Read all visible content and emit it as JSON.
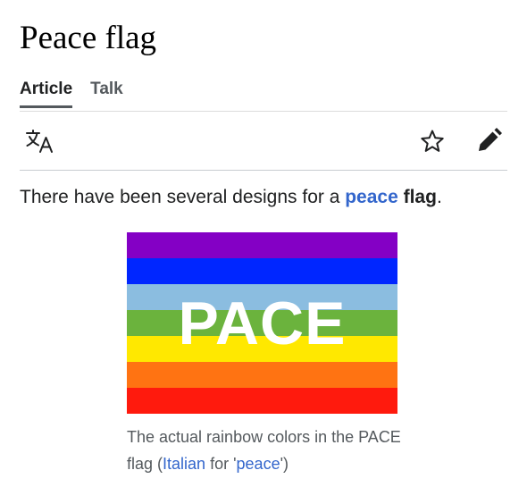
{
  "page": {
    "title": "Peace flag",
    "tabs": [
      {
        "label": "Article"
      },
      {
        "label": "Talk"
      }
    ]
  },
  "toolbar": {
    "icons": [
      "translate-icon",
      "star-icon",
      "pencil-icon"
    ]
  },
  "intro": {
    "text_before": "There have been several designs for a ",
    "link_text": "peace",
    "text_space": " ",
    "bold_text": "flag",
    "text_after": "."
  },
  "flag_image": {
    "text": "PACE",
    "stripe_colors": [
      "#8400C5",
      "#0026FF",
      "#8BBDE0",
      "#6BB33D",
      "#FFE800",
      "#FF7312",
      "#FF1A0D"
    ]
  },
  "caption": {
    "text1": "The actual rainbow colors in the PACE flag (",
    "link1": "Italian",
    "text2": " for '",
    "link2": "peace",
    "text3": "')"
  },
  "colors": {
    "link": "#3366cc",
    "text": "#202122",
    "secondary": "#54595d"
  }
}
